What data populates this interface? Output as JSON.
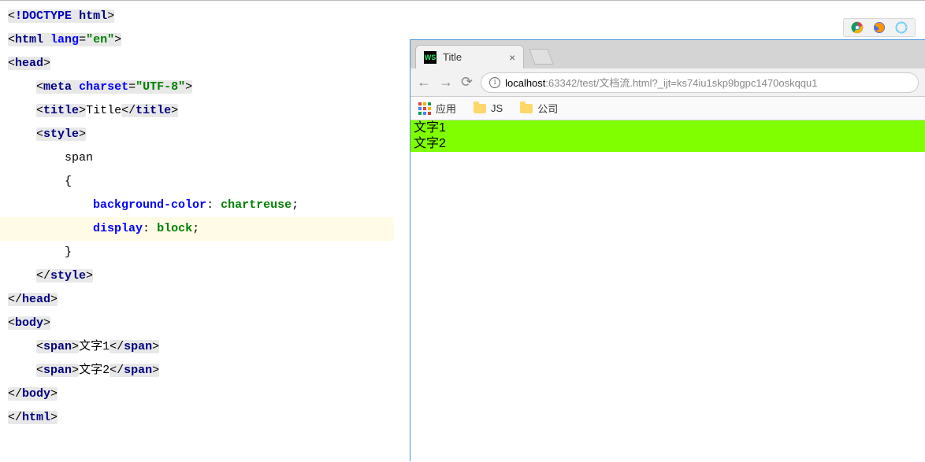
{
  "code": {
    "doctype": "DOCTYPE",
    "html_kw": "html",
    "lang_attr": "lang",
    "lang_val": "en",
    "head": "head",
    "meta": "meta",
    "charset_attr": "charset",
    "charset_val": "UTF-8",
    "title_tag": "title",
    "title_text": "Title",
    "style": "style",
    "selector": "span",
    "prop1": "background-color",
    "val1": "chartreuse",
    "prop2": "display",
    "val2": "block",
    "body": "body",
    "span_tag": "span",
    "span1_text": "文字1",
    "span2_text": "文字2"
  },
  "browser": {
    "tab_title": "Title",
    "url_host": "localhost",
    "url_rest": ":63342/test/文档流.html?_ijt=ks74iu1skp9bgpc1470oskqqu1",
    "bookmarks": {
      "apps_label": "应用",
      "folder1": "JS",
      "folder2": "公司"
    },
    "rendered": {
      "line1": "文字1",
      "line2": "文字2"
    }
  }
}
